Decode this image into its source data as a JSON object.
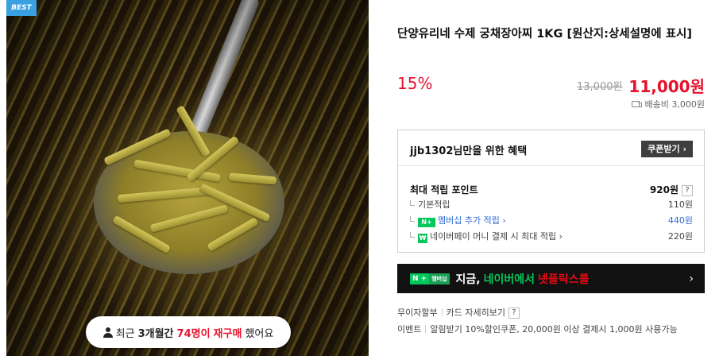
{
  "image": {
    "badge": "BEST",
    "repurchase": {
      "prefix": "최근",
      "period": "3개월간",
      "count": "74명이",
      "action": "재구매",
      "suffix": "했어요"
    }
  },
  "product": {
    "title": "단양유리네 수제 궁채장아찌 1KG [원산지:상세설명에 표시]",
    "discount_rate": "15%",
    "original_price": "13,000원",
    "sale_price": "11,000원",
    "shipping": "배송비 3,000원"
  },
  "benefits": {
    "heading": "jjb1302님만을 위한 혜택",
    "coupon_button": "쿠폰받기 ›",
    "max_points_label": "최대 적립 포인트",
    "max_points_value": "920원",
    "basic_label": "기본적립",
    "basic_value": "110원",
    "membership_label": "멤버십 추가 적립 ›",
    "membership_value": "440원",
    "npay_label": "네이버페이 머니 결제 시 최대 적립 ›",
    "npay_value": "220원",
    "help_icon": "?"
  },
  "banner": {
    "badge_n": "N +",
    "badge_sub": "멤버십",
    "text_white": "지금,",
    "text_green": "네이버에서",
    "text_red": "넷플릭스를",
    "arrow": "›"
  },
  "payment": {
    "installment": "무이자할부",
    "card_detail": "카드 자세히보기",
    "help_icon": "?",
    "event_label": "이벤트",
    "event_text": "알림받기 10%할인쿠폰, 20,000원 이상 결제시 1,000원 사용가능"
  },
  "colors": {
    "accent_red": "#e8112d",
    "naver_green": "#03c75a",
    "best_badge": "#3aa1e0"
  }
}
